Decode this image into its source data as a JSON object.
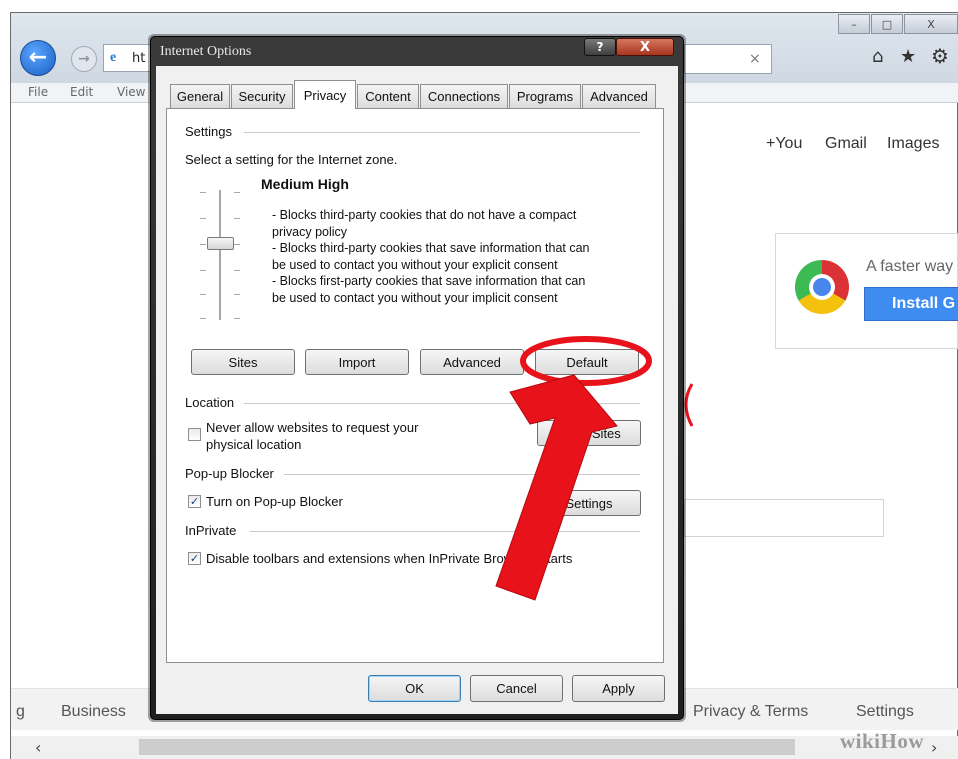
{
  "browser": {
    "address_text": "ht",
    "menu": [
      "File",
      "Edit",
      "View"
    ],
    "window_controls": [
      "–",
      "□",
      "X"
    ],
    "toolbar_icons": [
      "home-icon",
      "star-icon",
      "gear-icon"
    ],
    "google_links": [
      "+You",
      "Gmail",
      "Images"
    ],
    "promo_text": "A faster way",
    "promo_button": "Install G",
    "footer_links": {
      "left_fragment": "g",
      "business": "Business",
      "privacy": "Privacy & Terms",
      "settings": "Settings"
    },
    "watermark": "wikiHow"
  },
  "dialog": {
    "title": "Internet Options",
    "help_label": "?",
    "close_label": "X",
    "tabs": [
      "General",
      "Security",
      "Privacy",
      "Content",
      "Connections",
      "Programs",
      "Advanced"
    ],
    "active_tab": "Privacy",
    "settings": {
      "group_label": "Settings",
      "instruction": "Select a setting for the Internet zone.",
      "level_title": "Medium High",
      "description_lines": [
        "- Blocks third-party cookies that do not have a compact",
        "privacy policy",
        "- Blocks third-party cookies that save information that can",
        "be used to contact you without your explicit consent",
        "- Blocks first-party cookies that save information that can",
        "be used to contact you without your implicit consent"
      ],
      "slider_level": "Medium High",
      "buttons": [
        "Sites",
        "Import",
        "Advanced",
        "Default"
      ]
    },
    "location": {
      "group_label": "Location",
      "checkbox_line1": "Never allow websites to request your",
      "checkbox_line2": "physical location",
      "checked": false,
      "clear_sites_label": "Clear Sites"
    },
    "popup": {
      "group_label": "Pop-up Blocker",
      "checkbox_label": "Turn on Pop-up Blocker",
      "checked": true,
      "settings_button": "Settings"
    },
    "inprivate": {
      "group_label": "InPrivate",
      "checkbox_label": "Disable toolbars and extensions when InPrivate Browsing starts",
      "checked": true
    },
    "footer_buttons": {
      "ok": "OK",
      "cancel": "Cancel",
      "apply": "Apply"
    }
  },
  "annotation": {
    "color": "#e8121a",
    "target": "Default"
  },
  "colors": {
    "accent_blue": "#1f6fd1",
    "install_button": "#3f8cf0",
    "titlebar": "#1f1f1f"
  }
}
